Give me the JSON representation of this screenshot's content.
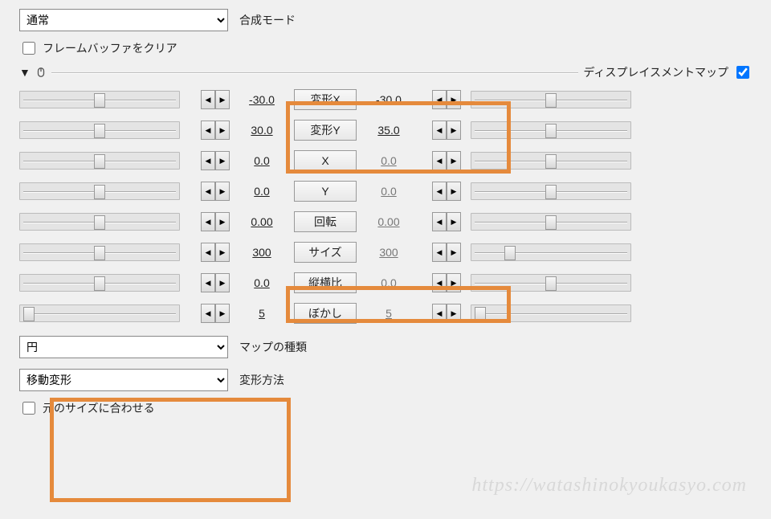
{
  "top": {
    "blend_mode_value": "通常",
    "blend_mode_label": "合成モード",
    "clear_framebuffer_label": "フレームバッファをクリア"
  },
  "section": {
    "title": "ディスプレイスメントマップ",
    "enabled": true
  },
  "params": [
    {
      "left_val": "-30.0",
      "label": "変形X",
      "right_val": "-30.0",
      "slider_left_pos": "mid",
      "slider_right_pos": "mid"
    },
    {
      "left_val": "30.0",
      "label": "変形Y",
      "right_val": "35.0",
      "slider_left_pos": "mid",
      "slider_right_pos": "mid"
    },
    {
      "left_val": "0.0",
      "label": "X",
      "right_val": "0.0",
      "right_dim": true,
      "slider_left_pos": "mid",
      "slider_right_pos": "mid"
    },
    {
      "left_val": "0.0",
      "label": "Y",
      "right_val": "0.0",
      "right_dim": true,
      "slider_left_pos": "mid",
      "slider_right_pos": "mid"
    },
    {
      "left_val": "0.00",
      "label": "回転",
      "right_val": "0.00",
      "right_dim": true,
      "slider_left_pos": "mid",
      "slider_right_pos": "mid"
    },
    {
      "left_val": "300",
      "label": "サイズ",
      "right_val": "300",
      "right_dim": true,
      "slider_left_pos": "mid",
      "slider_right_pos": "q"
    },
    {
      "left_val": "0.0",
      "label": "縦横比",
      "right_val": "0.0",
      "right_dim": true,
      "slider_left_pos": "mid",
      "slider_right_pos": "mid"
    },
    {
      "left_val": "5",
      "label": "ぼかし",
      "right_val": "5",
      "right_dim": true,
      "slider_left_pos": "low",
      "slider_right_pos": "low"
    }
  ],
  "bottom": {
    "map_type_value": "円",
    "map_type_label": "マップの種類",
    "deform_method_value": "移動変形",
    "deform_method_label": "変形方法",
    "fit_original_label": "元のサイズに合わせる"
  },
  "watermark": "https://watashinokyoukasyo.com"
}
